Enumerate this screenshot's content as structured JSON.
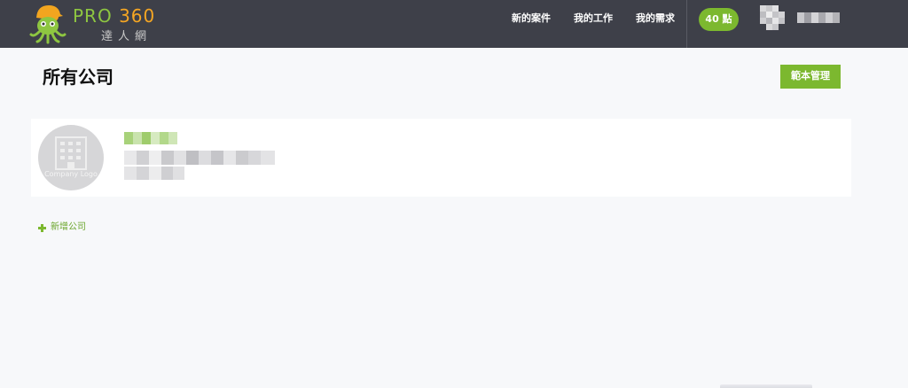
{
  "header": {
    "logo": {
      "brand_pro": "PRO",
      "brand_num": "360",
      "brand_sub": "達人網"
    },
    "nav": [
      {
        "label": "新的案件"
      },
      {
        "label": "我的工作"
      },
      {
        "label": "我的需求"
      }
    ],
    "points": {
      "label": "40 點"
    },
    "colors": {
      "bar": "#3e4049",
      "accent": "#7cb82f",
      "logo_orange": "#f5a623"
    }
  },
  "main": {
    "title": "所有公司",
    "template_button": "範本管理",
    "company": {
      "logo_placeholder": "Company Logo"
    },
    "add_company": "新增公司"
  }
}
